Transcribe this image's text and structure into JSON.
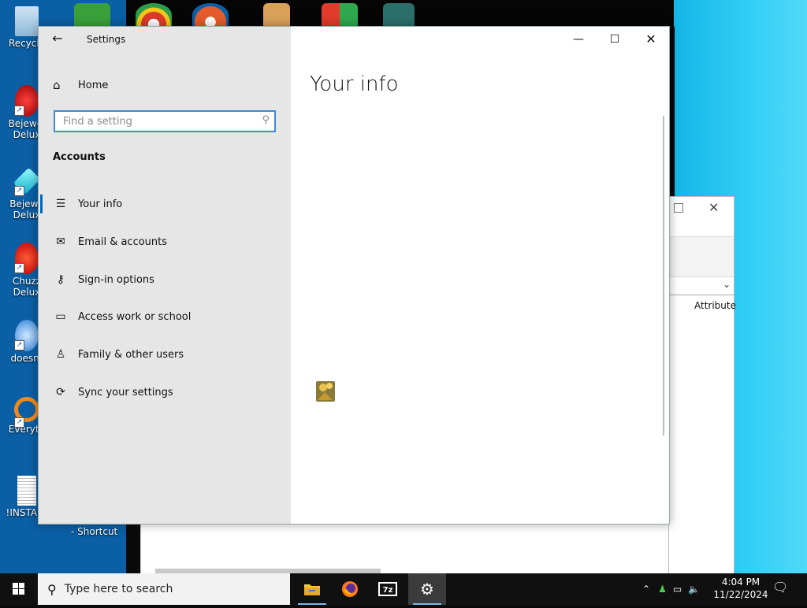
{
  "desktop": {
    "icons": [
      {
        "label": "Recycle"
      },
      {
        "label": "Bejewel Delux"
      },
      {
        "label": "Bejewe Delux"
      },
      {
        "label": "Chuzz Delux"
      },
      {
        "label": "doesnt"
      },
      {
        "label": "Everyth"
      },
      {
        "label": "!INSTALL"
      }
    ],
    "shortcut_label": "- Shortcut"
  },
  "background_window": {
    "column_header": "Attribute"
  },
  "settings": {
    "window_title": "Settings",
    "home_label": "Home",
    "search_placeholder": "Find a setting",
    "section_title": "Accounts",
    "nav_items": [
      {
        "label": "Your info",
        "icon": "person-card-icon"
      },
      {
        "label": "Email & accounts",
        "icon": "mail-icon"
      },
      {
        "label": "Sign-in options",
        "icon": "key-icon"
      },
      {
        "label": "Access work or school",
        "icon": "briefcase-icon"
      },
      {
        "label": "Family & other users",
        "icon": "person-add-icon"
      },
      {
        "label": "Sync your settings",
        "icon": "sync-icon"
      }
    ],
    "selected_item": "Your info",
    "page_heading": "Your info"
  },
  "taskbar": {
    "search_placeholder": "Type here to search",
    "apps": [
      "File Explorer",
      "Firefox",
      "7-Zip",
      "Settings"
    ],
    "time": "4:04 PM",
    "date": "11/22/2024"
  },
  "colors": {
    "accent": "#0067c0",
    "search_border": "#3b8bd9",
    "sidebar_bg": "#e6e6e6"
  }
}
